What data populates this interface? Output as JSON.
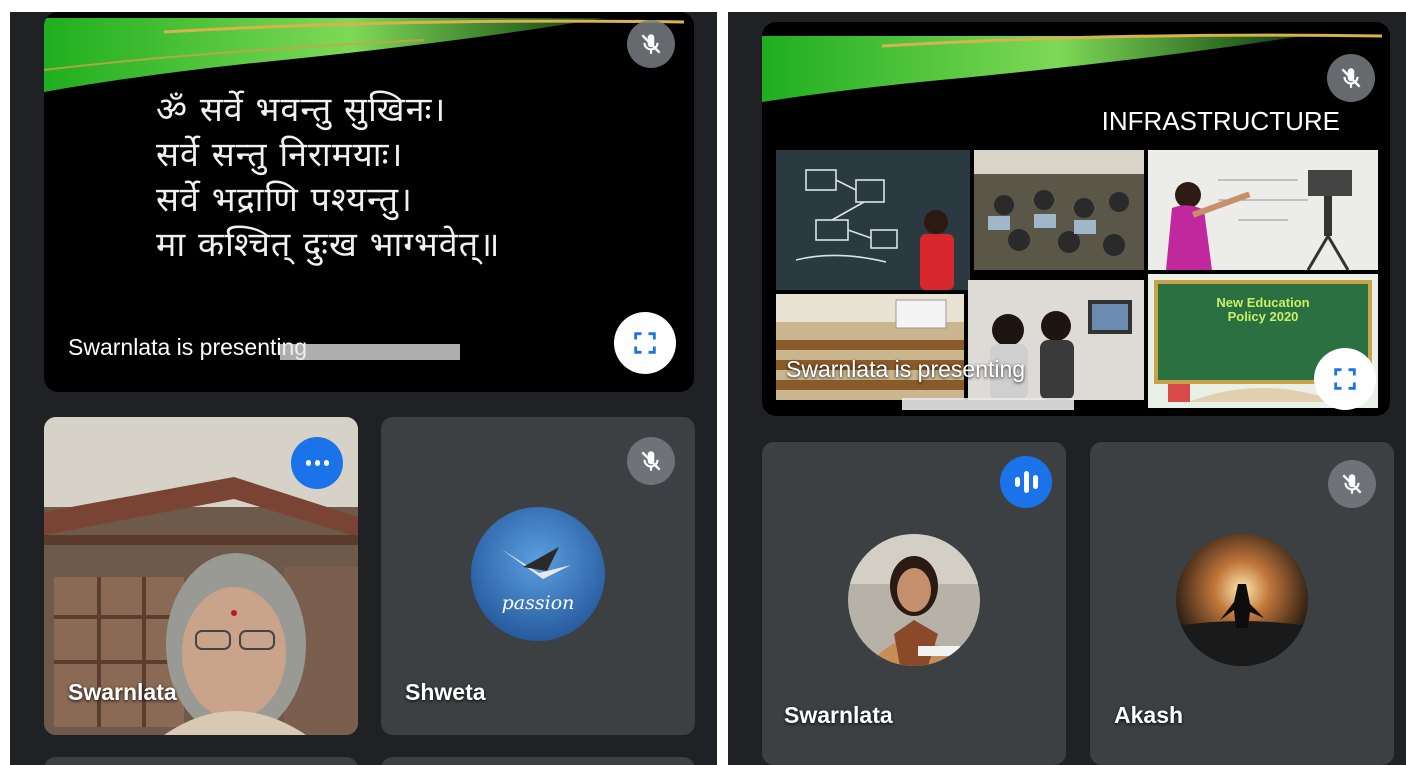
{
  "left": {
    "slide": {
      "lines": [
        "ॐ सर्वे भवन्तु सुखिनः।",
        "सर्वे सन्तु निरामयाः।",
        "सर्वे भद्राणि पश्यन्तु।",
        "मा कश्चित् दुःख भाग्भवेत्॥"
      ],
      "presenting_label": "Swarnlata is presenting"
    },
    "tiles": [
      {
        "name": "Swarnlata",
        "status": "speaking"
      },
      {
        "name": "Shweta",
        "status": "muted",
        "avatar_text": "passion"
      }
    ]
  },
  "right": {
    "slide": {
      "title": "INFRASTRUCTURE",
      "nep_text": "New Education Policy 2020",
      "presenting_label": "Swarnlata is presenting"
    },
    "tiles": [
      {
        "name": "Swarnlata",
        "status": "speaking"
      },
      {
        "name": "Akash",
        "status": "muted"
      }
    ]
  },
  "icons": {
    "mic_off": "mic-off-icon",
    "speaking": "audio-level-icon",
    "fullscreen": "fullscreen-icon"
  },
  "colors": {
    "background": "#202124",
    "tile": "#3c4043",
    "speaking": "#1a73e8",
    "banner_green": "#2fb52f"
  }
}
